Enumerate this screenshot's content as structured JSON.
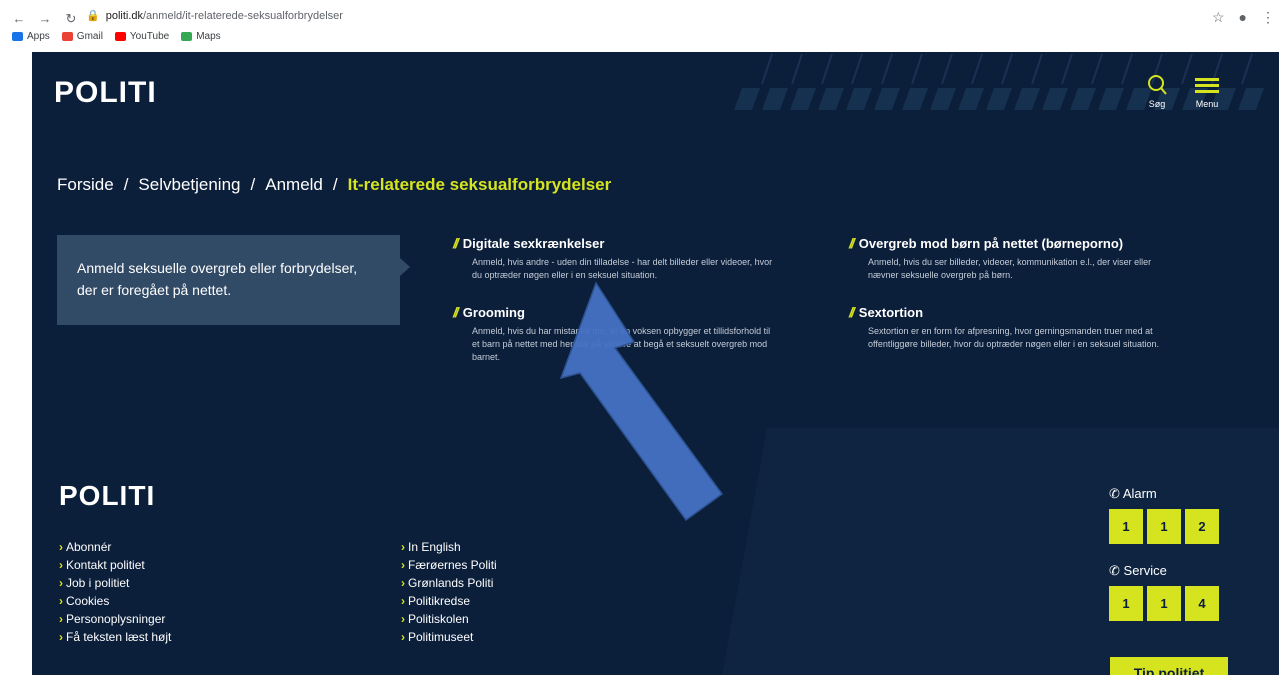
{
  "browser": {
    "url_domain": "politi.dk",
    "url_path": "/anmeld/it-relaterede-seksualforbrydelser",
    "bookmarks": [
      {
        "label": "Apps",
        "color": "#1a73e8"
      },
      {
        "label": "Gmail",
        "color": "#ea4335"
      },
      {
        "label": "YouTube",
        "color": "#ff0000"
      },
      {
        "label": "Maps",
        "color": "#34a853"
      }
    ]
  },
  "colors": {
    "background": "#0b1e3a",
    "accent": "#d6e41f",
    "panel": "#314a66",
    "annotation_arrow": "#4472c4"
  },
  "header": {
    "logo": "POLITI",
    "search_label": "Søg",
    "menu_label": "Menu"
  },
  "breadcrumb": {
    "items": [
      "Forside",
      "Selvbetjening",
      "Anmeld"
    ],
    "separator": "/",
    "current": "It-relaterede seksualforbrydelser"
  },
  "intro": "Anmeld seksuelle overgreb eller forbrydelser, der er foregået på nettet.",
  "cards": [
    {
      "title": "Digitale sexkrænkelser",
      "description": "Anmeld, hvis andre - uden din tilladelse - har delt billeder eller videoer, hvor du optræder nøgen eller i en seksuel situation."
    },
    {
      "title": "Overgreb mod børn på nettet (børneporno)",
      "description": "Anmeld, hvis du ser billeder, videoer, kommunikation e.l., der viser eller nævner seksuelle overgreb på børn."
    },
    {
      "title": "Grooming",
      "description": "Anmeld, hvis du har mistanke om, at en voksen opbygger et tillidsforhold til et barn på nettet med henblik på senere at begå et seksuelt overgreb mod barnet."
    },
    {
      "title": "Sextortion",
      "description": "Sextortion er en form for afpresning, hvor gerningsmanden truer med at offentliggøre billeder, hvor du optræder nøgen eller i en seksuel situation."
    }
  ],
  "footer": {
    "logo": "POLITI",
    "links_left": [
      "Abonnér",
      "Kontakt politiet",
      "Job i politiet",
      "Cookies",
      "Personoplysninger",
      "Få teksten læst højt"
    ],
    "links_right": [
      "In English",
      "Færøernes Politi",
      "Grønlands Politi",
      "Politikredse",
      "Politiskolen",
      "Politimuseet"
    ],
    "alarm_label": "Alarm",
    "alarm_digits": [
      "1",
      "1",
      "2"
    ],
    "service_label": "Service",
    "service_digits": [
      "1",
      "1",
      "4"
    ],
    "tip_button": "Tip politiet"
  }
}
